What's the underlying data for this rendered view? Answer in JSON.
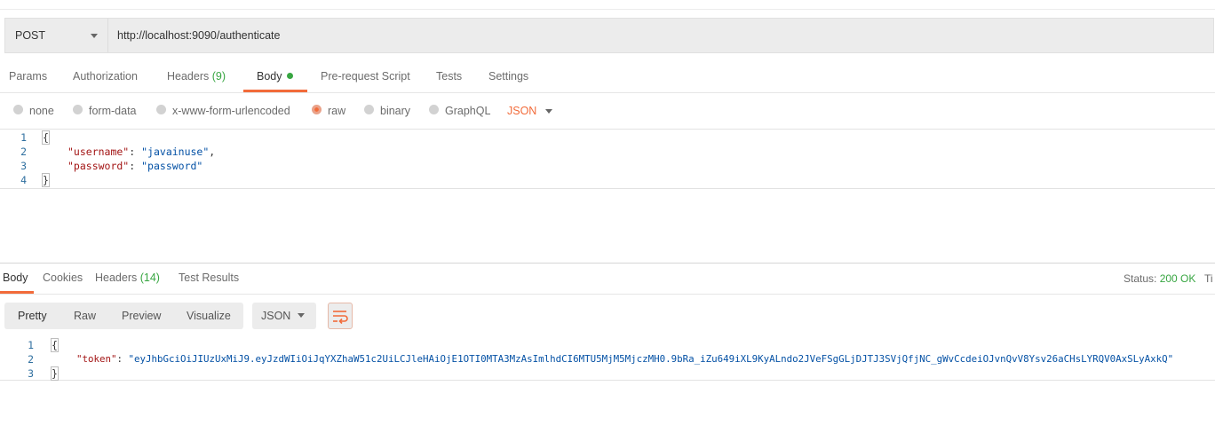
{
  "request": {
    "method": "POST",
    "url": "http://localhost:9090/authenticate"
  },
  "request_tabs": [
    {
      "label": "Params"
    },
    {
      "label": "Authorization"
    },
    {
      "label": "Headers",
      "count": "(9)"
    },
    {
      "label": "Body"
    },
    {
      "label": "Pre-request Script"
    },
    {
      "label": "Tests"
    },
    {
      "label": "Settings"
    }
  ],
  "body_types": [
    "none",
    "form-data",
    "x-www-form-urlencoded",
    "raw",
    "binary",
    "GraphQL"
  ],
  "body_format": "JSON",
  "request_body": {
    "line_numbers": [
      "1",
      "2",
      "3",
      "4"
    ],
    "open_brace": "{",
    "close_brace": "}",
    "username_key": "\"username\"",
    "username_value": "\"javainuse\"",
    "password_key": "\"password\"",
    "password_value": "\"password\"",
    "colon": ":",
    "comma": ","
  },
  "response_tabs": [
    {
      "label": "Body"
    },
    {
      "label": "Cookies"
    },
    {
      "label": "Headers",
      "count": "(14)"
    },
    {
      "label": "Test Results"
    }
  ],
  "status": {
    "label": "Status:",
    "value": "200 OK",
    "time_label": "Ti"
  },
  "view_modes": [
    "Pretty",
    "Raw",
    "Preview",
    "Visualize"
  ],
  "response_format": "JSON",
  "response_body": {
    "line_numbers": [
      "1",
      "2",
      "3"
    ],
    "open_brace": "{",
    "close_brace": "}",
    "token_key": "\"token\"",
    "token_value": "\"eyJhbGciOiJIUzUxMiJ9.eyJzdWIiOiJqYXZhaW51c2UiLCJleHAiOjE1OTI0MTA3MzAsImlhdCI6MTU5MjM5MjczMH0.9bRa_iZu649iXL9KyALndo2JVeFSgGLjDJTJ3SVjQfjNC_gWvCcdeiOJvnQvV8Ysv26aCHsLYRQV0AxSLyAxkQ\"",
    "colon": ":"
  },
  "colors": {
    "accent": "#f26b3a",
    "success": "#38a642"
  }
}
